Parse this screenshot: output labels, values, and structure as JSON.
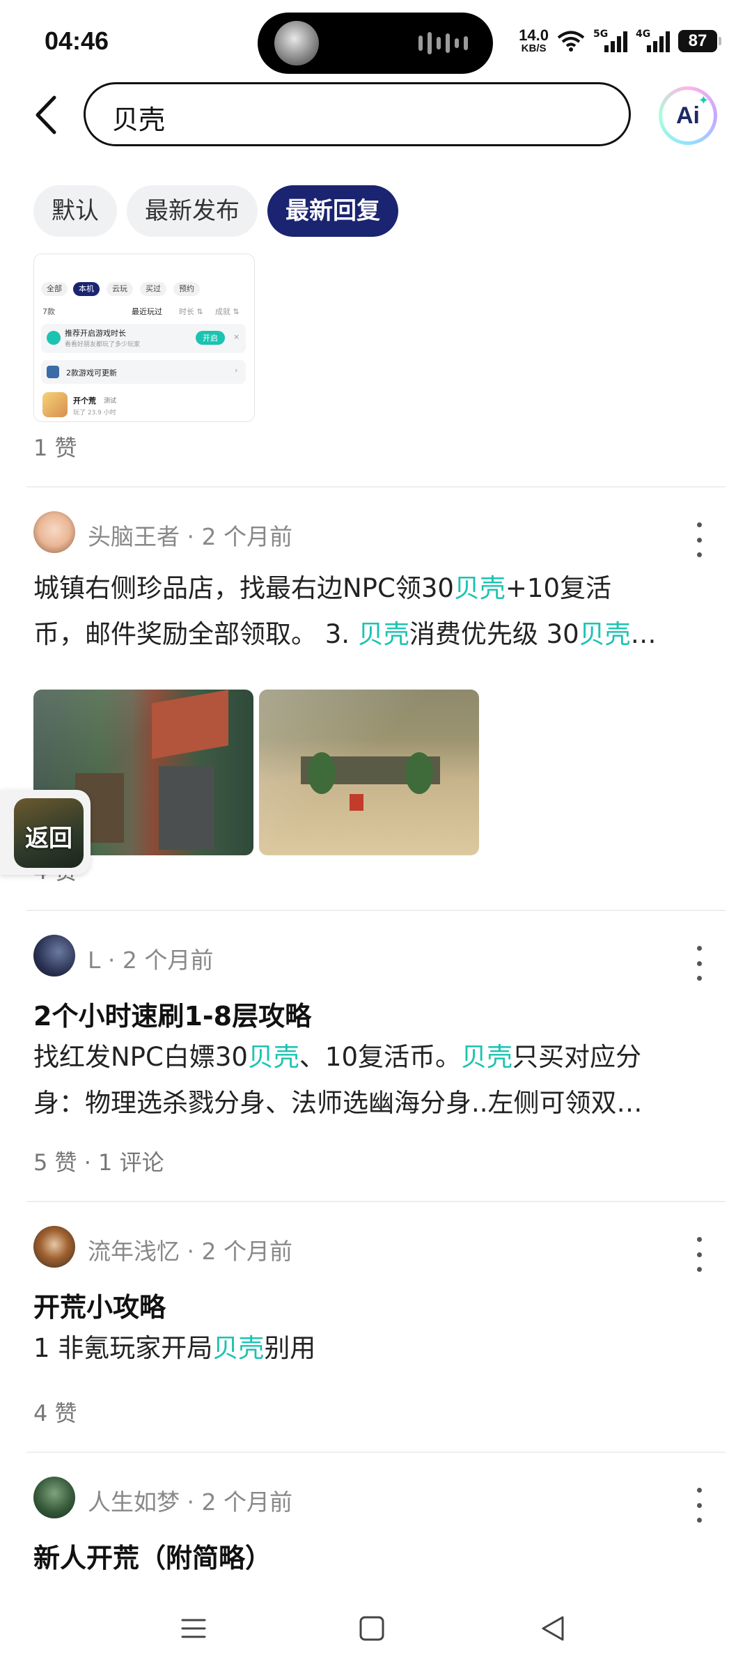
{
  "status_bar": {
    "time": "04:46",
    "net_speed_value": "14.0",
    "net_speed_unit": "KB/S",
    "signal1_label": "5G",
    "signal2_label": "4G",
    "battery": "87"
  },
  "header": {
    "search_value": "贝壳",
    "ai_label": "Ai"
  },
  "tabs": [
    {
      "label": "默认",
      "active": false
    },
    {
      "label": "最新发布",
      "active": false
    },
    {
      "label": "最新回复",
      "active": true
    }
  ],
  "top_card": {
    "shot_tabs": [
      "全部",
      "本机",
      "云玩",
      "买过",
      "预约"
    ],
    "count": "7款",
    "sorts": [
      "最近玩过",
      "时长 ⇅",
      "成就 ⇅"
    ],
    "tip_title": "推荐开启游戏时长",
    "tip_sub": "看看好朋友都玩了多少玩家",
    "tip_btn": "开启",
    "update_text": "2款游戏可更新",
    "game_name": "开个荒",
    "game_tag": "测试",
    "game_time": "玩了 23.9 小时",
    "likes": "1 赞"
  },
  "posts": [
    {
      "author": "头脑王者",
      "time": "2 个月前",
      "body_segments": [
        {
          "t": "城镇右侧珍品店，找最右边NPC领30"
        },
        {
          "t": "贝壳",
          "h": true
        },
        {
          "t": "+10复活币，邮件奖励全部领取。 3. "
        },
        {
          "t": "贝壳",
          "h": true
        },
        {
          "t": "消费优先级 30"
        },
        {
          "t": "贝壳",
          "h": true
        },
        {
          "t": "…"
        }
      ],
      "body_line1": [
        "城镇右侧珍品店，找最右边NPC领30",
        "贝壳",
        "+10复活"
      ],
      "body_line2": [
        "币，邮件奖励全部领取。 3. ",
        "贝壳",
        "消费优先级 30",
        "贝壳",
        "…"
      ],
      "stats": "4 赞"
    },
    {
      "author": "L",
      "time": "2 个月前",
      "title": "2个小时速刷1-8层攻略",
      "body_line1": [
        "找红发NPC白嫖30",
        "贝壳",
        "、10复活币。",
        "贝壳",
        "只买对应分"
      ],
      "body_line2": [
        "身：物理选杀戮分身、法师选幽海分身..左侧可领双…"
      ],
      "stats": "5 赞 · 1 评论"
    },
    {
      "author": "流年浅忆",
      "time": "2 个月前",
      "title": "开荒小攻略",
      "body_line1": [
        "1  非氪玩家开局",
        "贝壳",
        "别用"
      ],
      "stats": "4 赞"
    },
    {
      "author": "人生如梦",
      "time": "2 个月前",
      "title": "新人开荒（附简略）"
    }
  ],
  "floating_return": "返回",
  "colors": {
    "accent": "#1b2470",
    "highlight": "#1bc3b1"
  },
  "icons": [
    "back-arrow-icon",
    "more-icon",
    "menu-icon",
    "home-icon",
    "back-triangle-icon"
  ]
}
